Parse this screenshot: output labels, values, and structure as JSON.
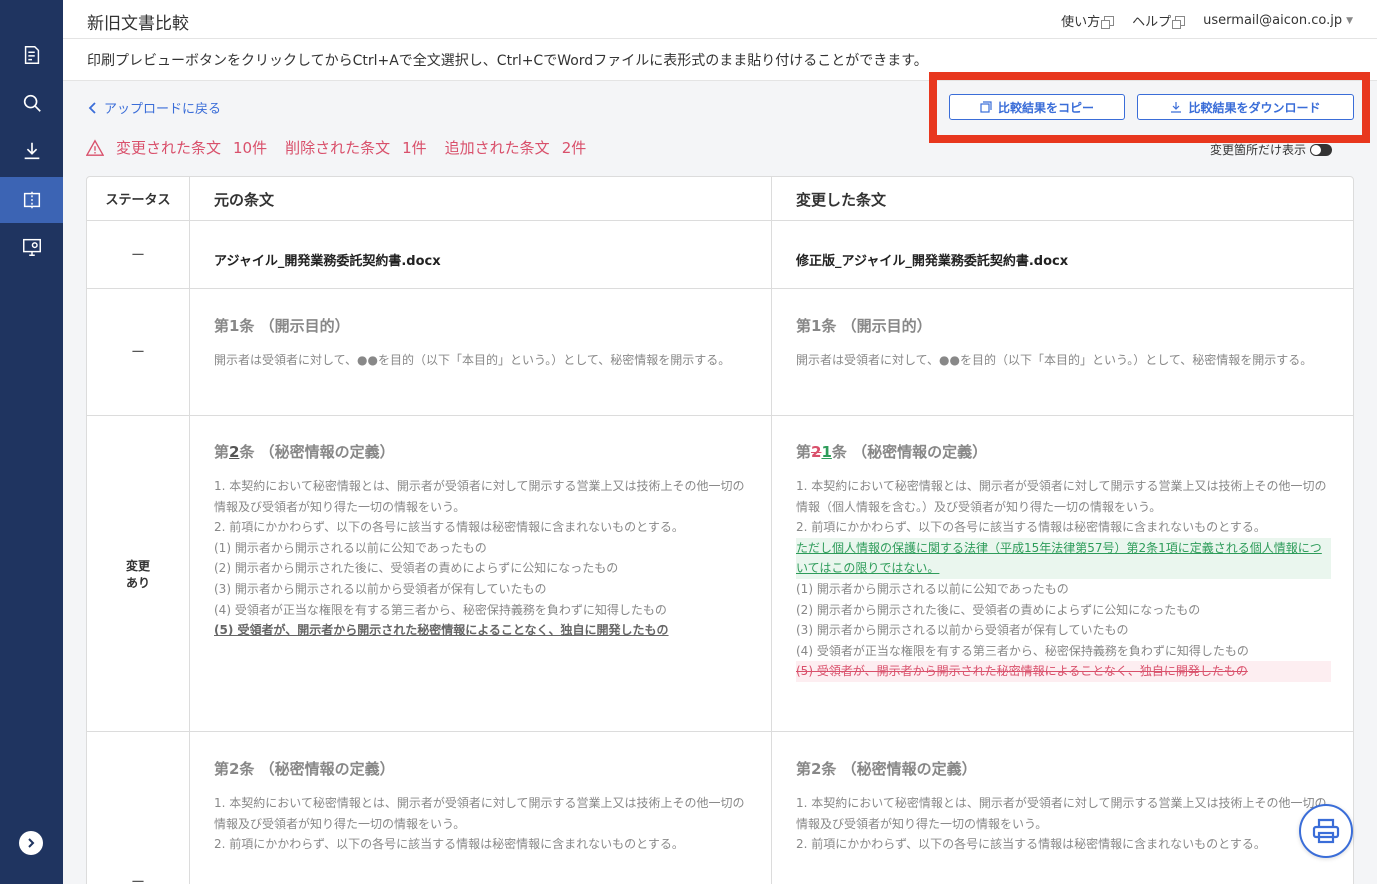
{
  "header": {
    "title": "新旧文書比較",
    "help_usage": "使い方",
    "help": "ヘルプ",
    "user_email": "usermail@aicon.co.jp"
  },
  "notice": "印刷プレビューボタンをクリックしてからCtrl+Aで全文選択し、Ctrl+CでWordファイルに表形式のまま貼り付けることができます。",
  "toolbar": {
    "back_label": "アップロードに戻る",
    "copy_label": "比較結果をコピー",
    "download_label": "比較結果をダウンロード",
    "toggle_label": "変更箇所だけ表示"
  },
  "summary": {
    "changed_label": "変更された条文",
    "changed_count": "10件",
    "deleted_label": "削除された条文",
    "deleted_count": "1件",
    "added_label": "追加された条文",
    "added_count": "2件"
  },
  "table": {
    "headers": {
      "status": "ステータス",
      "original": "元の条文",
      "changed": "変更した条文"
    },
    "file_row": {
      "status": "ー",
      "original": "アジャイル_開発業務委託契約書.docx",
      "changed": "修正版_アジャイル_開発業務委託契約書.docx"
    },
    "row1": {
      "status": "ー",
      "orig_title": "第1条 （開示目的）",
      "orig_body": "開示者は受領者に対して、●●を目的（以下「本目的」という。）として、秘密情報を開示する。",
      "new_title": "第1条 （開示目的）",
      "new_body": "開示者は受領者に対して、●●を目的（以下「本目的」という。）として、秘密情報を開示する。"
    },
    "row2": {
      "status_line1": "変更",
      "status_line2": "あり",
      "orig_title_pre": "第",
      "orig_title_num": "2",
      "orig_title_post": "条 （秘密情報の定義）",
      "orig_lines": [
        "1. 本契約において秘密情報とは、開示者が受領者に対して開示する営業上又は技術上その他一切の情報及び受領者が知り得た一切の情報をいう。",
        "2. 前項にかかわらず、以下の各号に該当する情報は秘密情報に含まれないものとする。",
        "(1) 開示者から開示される以前に公知であったもの",
        "(2) 開示者から開示された後に、受領者の責めによらずに公知になったもの",
        "(3) 開示者から開示される以前から受領者が保有していたもの",
        "(4) 受領者が正当な権限を有する第三者から、秘密保持義務を負わずに知得したもの"
      ],
      "orig_bold_line": "(5) 受領者が、開示者から開示された秘密情報によることなく、独自に開発したもの",
      "new_title_pre": "第",
      "new_title_del": "2",
      "new_title_ins": "1",
      "new_title_post": "条 （秘密情報の定義）",
      "new_line1": " 1. 本契約において秘密情報とは、開示者が受領者に対して開示する営業上又は技術上その他一切の情報（個人情報を含む。）及び受領者が知り得た一切の情報をいう。",
      "new_line2": "2. 前項にかかわらず、以下の各号に該当する情報は秘密情報に含まれないものとする。",
      "new_inserted": "ただし個人情報の保護に関する法律（平成15年法律第57号）第2条1項に定義される個人情報についてはこの限りではない。",
      "new_lines": [
        "(1) 開示者から開示される以前に公知であったもの",
        "(2) 開示者から開示された後に、受領者の責めによらずに公知になったもの",
        "(3) 開示者から開示される以前から受領者が保有していたもの",
        "(4) 受領者が正当な権限を有する第三者から、秘密保持義務を負わずに知得したもの"
      ],
      "new_deleted": "(5) 受領者が、開示者から開示された秘密情報によることなく、独自に開発したもの"
    },
    "row3": {
      "status": "ー",
      "orig_title": "第2条 （秘密情報の定義）",
      "orig_line1": "1. 本契約において秘密情報とは、開示者が受領者に対して開示する営業上又は技術上その他一切の情報及び受領者が知り得た一切の情報をいう。",
      "orig_line2": "2. 前項にかかわらず、以下の各号に該当する情報は秘密情報に含まれないものとする。",
      "new_title": "第2条 （秘密情報の定義）",
      "new_line1": "1. 本契約において秘密情報とは、開示者が受領者に対して開示する営業上又は技術上その他一切の情報及び受領者が知り得た一切の情報をいう。",
      "new_line2": "2. 前項にかかわらず、以下の各号に該当する情報は秘密情報に含まれないものとする。"
    }
  },
  "colors": {
    "sidebar": "#1f3460",
    "sidebar_active": "#3c64b4",
    "accent": "#3a6dd8",
    "alert": "#d9506b",
    "insert": "#2e9c5a",
    "highlight_box": "#e8371e"
  }
}
